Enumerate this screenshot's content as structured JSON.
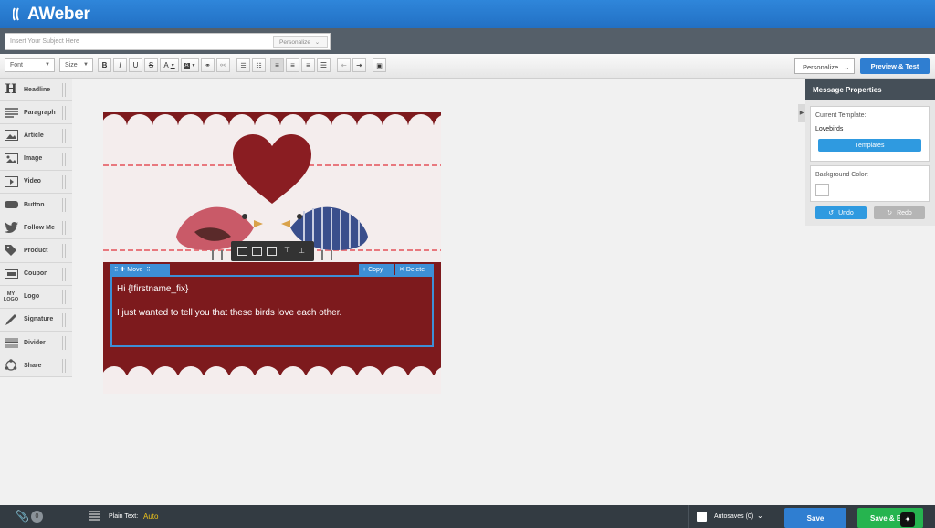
{
  "app": {
    "logo_text": "AWeber"
  },
  "subject": {
    "placeholder": "Insert Your Subject Here",
    "personalize_label": "Personalize"
  },
  "toolbar": {
    "font_label": "Font",
    "size_label": "Size",
    "bold": "B",
    "italic": "I",
    "underline": "U",
    "strike": "S",
    "text_color": "A",
    "personalize_label": "Personalize",
    "preview_label": "Preview & Test"
  },
  "sidebar": {
    "items": [
      {
        "label": "Headline",
        "icon": "headline-icon"
      },
      {
        "label": "Paragraph",
        "icon": "paragraph-icon"
      },
      {
        "label": "Article",
        "icon": "article-icon"
      },
      {
        "label": "Image",
        "icon": "image-icon"
      },
      {
        "label": "Video",
        "icon": "video-icon"
      },
      {
        "label": "Button",
        "icon": "button-icon"
      },
      {
        "label": "Follow Me",
        "icon": "twitter-icon"
      },
      {
        "label": "Product",
        "icon": "tag-icon"
      },
      {
        "label": "Coupon",
        "icon": "coupon-icon"
      },
      {
        "label": "Logo",
        "icon": "logo-icon"
      },
      {
        "label": "Signature",
        "icon": "pen-icon"
      },
      {
        "label": "Divider",
        "icon": "divider-icon"
      },
      {
        "label": "Share",
        "icon": "share-icon"
      }
    ]
  },
  "editor": {
    "move_label": "Move",
    "copy_label": "Copy",
    "delete_label": "Delete",
    "greeting": "Hi {!firstname_fix}",
    "body": "I just wanted to tell you that these birds love each other.",
    "logo_icon_text": "MY LOGO"
  },
  "properties": {
    "title": "Message Properties",
    "current_template_label": "Current Template:",
    "template_name": "Lovebirds",
    "templates_button": "Templates",
    "background_color_label": "Background Color:",
    "undo_label": "Undo",
    "redo_label": "Redo"
  },
  "bottom": {
    "attachments_count": "0",
    "plain_text_label": "Plain Text:",
    "plain_text_value": "Auto",
    "autosaves_label": "Autosaves (0)",
    "save_label": "Save",
    "save_exit_label": "Save & E"
  },
  "colors": {
    "brand_blue": "#2a7bd1",
    "canvas_red": "#7d1a1d",
    "accent_blue": "#3d8fd6",
    "save_exit_green": "#26b44f",
    "auto_yellow": "#f0c419"
  }
}
